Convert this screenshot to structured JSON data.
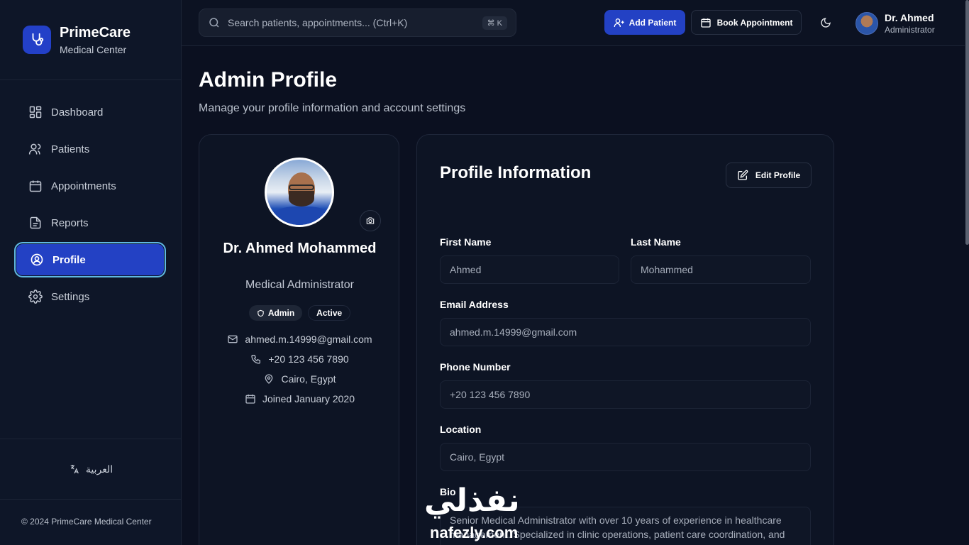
{
  "brand": {
    "name": "PrimeCare",
    "subtitle": "Medical Center"
  },
  "nav": [
    {
      "label": "Dashboard",
      "icon": "dashboard-icon"
    },
    {
      "label": "Patients",
      "icon": "users-icon"
    },
    {
      "label": "Appointments",
      "icon": "calendar-icon"
    },
    {
      "label": "Reports",
      "icon": "file-text-icon"
    },
    {
      "label": "Profile",
      "icon": "user-circle-icon",
      "active": true
    },
    {
      "label": "Settings",
      "icon": "gear-icon"
    }
  ],
  "language": {
    "label": "العربية",
    "icon": "translate-icon"
  },
  "footer": {
    "copyright": "© 2024 PrimeCare Medical Center"
  },
  "topbar": {
    "search_placeholder": "Search patients, appointments... (Ctrl+K)",
    "search_shortcut": "⌘ K",
    "add_patient": "Add Patient",
    "book_appointment": "Book Appointment",
    "user_name": "Dr. Ahmed",
    "user_role": "Administrator"
  },
  "page": {
    "title": "Admin Profile",
    "subtitle": "Manage your profile information and account settings"
  },
  "profile_card": {
    "name": "Dr. Ahmed Mohammed",
    "role": "Medical Administrator",
    "badge_admin": "Admin",
    "badge_status": "Active",
    "email": "ahmed.m.14999@gmail.com",
    "phone": "+20 123 456 7890",
    "location": "Cairo, Egypt",
    "joined": "Joined January 2020"
  },
  "form": {
    "title": "Profile Information",
    "edit_button": "Edit Profile",
    "first_name_label": "First Name",
    "first_name": "Ahmed",
    "last_name_label": "Last Name",
    "last_name": "Mohammed",
    "email_label": "Email Address",
    "email": "ahmed.m.14999@gmail.com",
    "phone_label": "Phone Number",
    "phone": "+20 123 456 7890",
    "location_label": "Location",
    "location": "Cairo, Egypt",
    "bio_label": "Bio",
    "bio": "Senior Medical Administrator with over 10 years of experience in healthcare management. Specialized in clinic operations, patient care coordination, and medical staff supervision."
  },
  "watermark": {
    "arabic": "نفذلي",
    "latin": "nafezly.com"
  },
  "colors": {
    "accent": "#2341c4",
    "active_ring": "#5fb8e0",
    "background": "#0b1020"
  }
}
